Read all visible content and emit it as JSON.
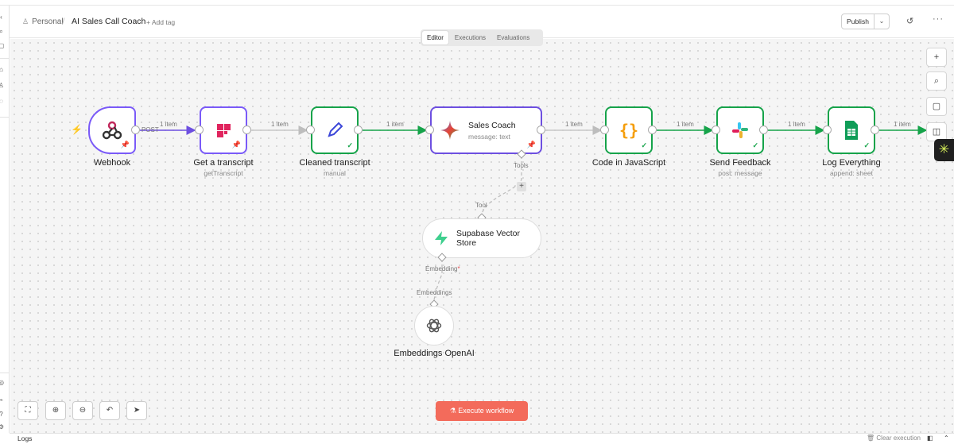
{
  "header": {
    "breadcrumb_project": "Personal",
    "workflow_title": "AI Sales Call Coach",
    "add_tag": "+ Add tag",
    "publish": "Publish"
  },
  "tabs": [
    {
      "label": "Editor",
      "active": true
    },
    {
      "label": "Executions",
      "active": false
    },
    {
      "label": "Evaluations",
      "active": false
    }
  ],
  "nodes": {
    "webhook": {
      "label": "Webhook",
      "sub": ""
    },
    "transcript": {
      "label": "Get a transcript",
      "sub": "getTranscript"
    },
    "cleaned": {
      "label": "Cleaned transcript",
      "sub": "manual"
    },
    "coach": {
      "label": "Sales Coach",
      "sub": "message: text"
    },
    "code": {
      "label": "Code in JavaScript",
      "sub": ""
    },
    "feedback": {
      "label": "Send Feedback",
      "sub": "post: message"
    },
    "log": {
      "label": "Log Everything",
      "sub": "append: sheet"
    },
    "supabase": {
      "label_line1": "Supabase Vector",
      "label_line2": "Store"
    },
    "openai": {
      "label": "Embeddings OpenAI"
    }
  },
  "edges": {
    "post": "POST",
    "item": "1 item",
    "tools": "Tools",
    "tool": "Tool",
    "embedding": "Embedding",
    "embedding_required": "*",
    "embeddings": "Embeddings"
  },
  "colors": {
    "purple": "#7a5af8",
    "green": "#16a34a",
    "execute": "#f36b5b"
  },
  "footer": {
    "execute": "Execute workflow",
    "logs": "Logs",
    "clear": "Clear execution"
  }
}
